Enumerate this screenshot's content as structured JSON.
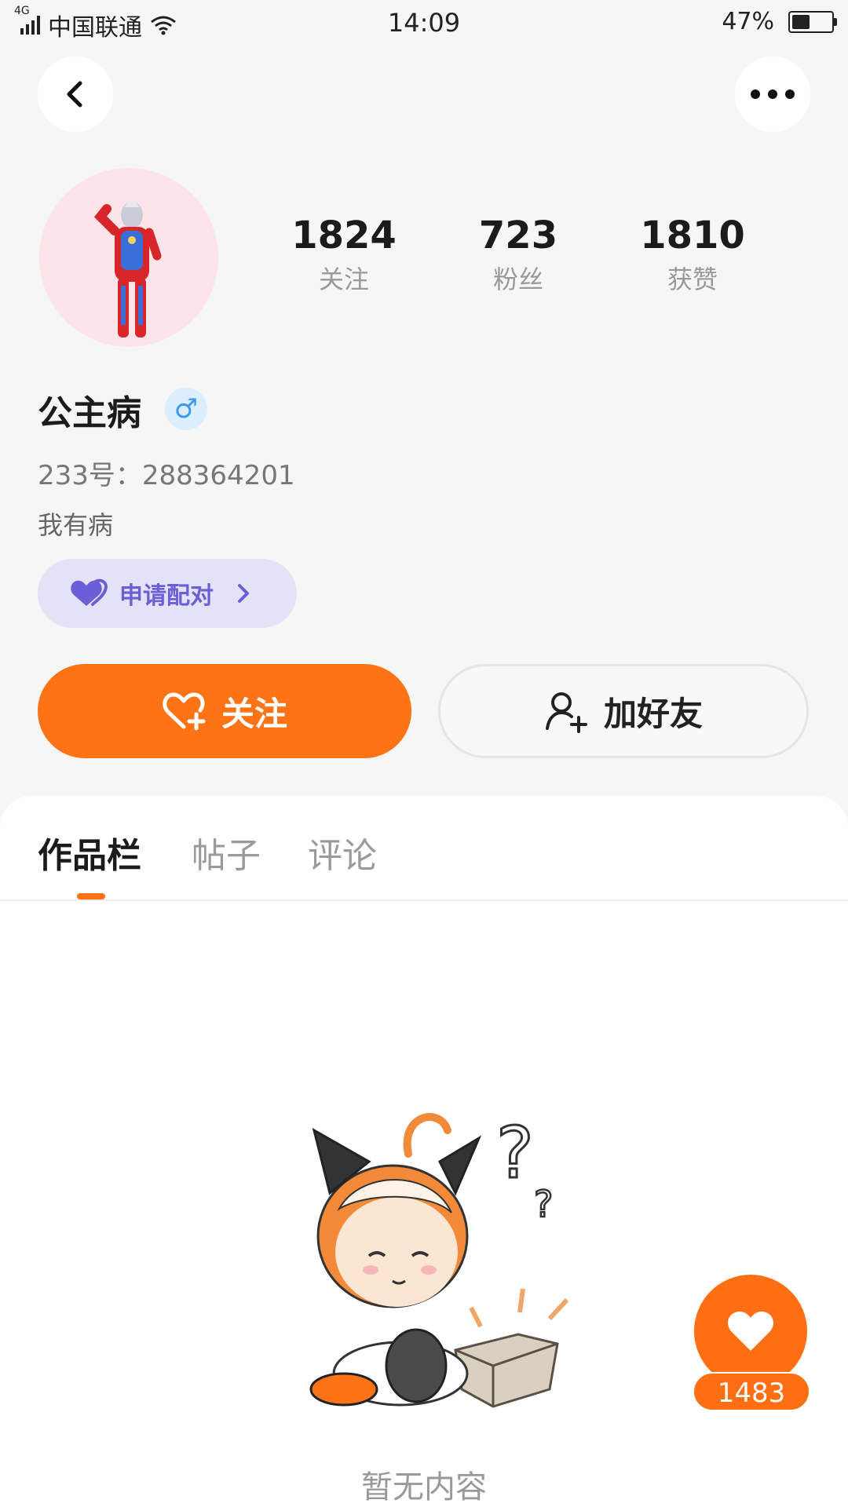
{
  "status_bar": {
    "network": "4G",
    "carrier": "中国联通",
    "time": "14:09",
    "battery_percent": "47%",
    "battery_level": 0.47
  },
  "profile": {
    "stats": [
      {
        "value": "1824",
        "label": "关注"
      },
      {
        "value": "723",
        "label": "粉丝"
      },
      {
        "value": "1810",
        "label": "获赞"
      }
    ],
    "name": "公主病",
    "gender_symbol": "♂",
    "uid": "233号：288364201",
    "bio": "我有病"
  },
  "pair_button": {
    "label": "申请配对"
  },
  "actions": {
    "follow_label": "关注",
    "add_friend_label": "加好友"
  },
  "tabs": [
    {
      "label": "作品栏",
      "active": true
    },
    {
      "label": "帖子",
      "active": false
    },
    {
      "label": "评论",
      "active": false
    }
  ],
  "empty_state": {
    "text": "暂无内容"
  },
  "like_fab": {
    "count": "1483"
  },
  "colors": {
    "accent": "#fe7316",
    "pair_bg": "#e3e2f6",
    "pair_text": "#6a5fd6",
    "gender_badge": "#3a9af0"
  }
}
